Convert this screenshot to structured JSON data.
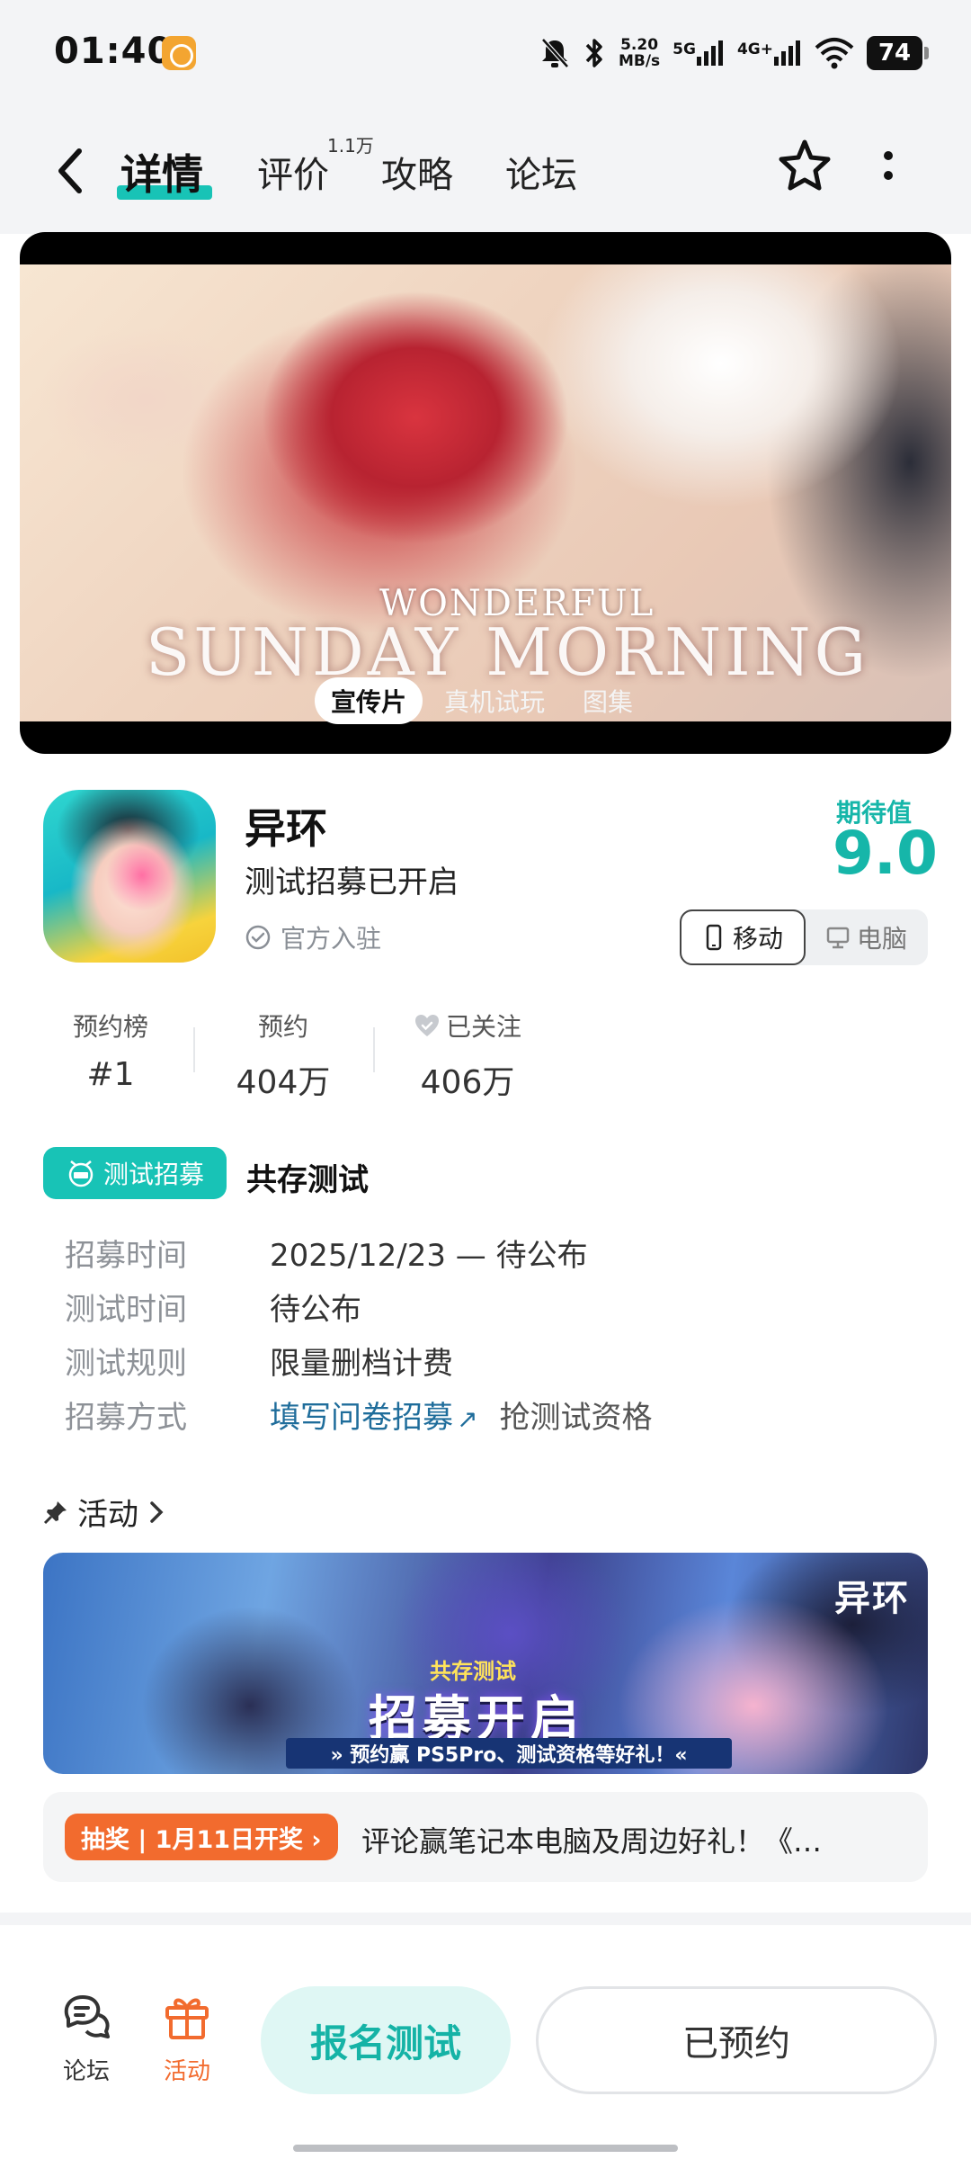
{
  "status_bar": {
    "time": "01:40",
    "net_speed_value": "5.20",
    "net_speed_unit": "MB/s",
    "signal1_label": "5G",
    "signal2_label": "4G+",
    "battery": "74"
  },
  "nav": {
    "tabs": [
      {
        "label": "详情"
      },
      {
        "label": "评价"
      },
      {
        "label": "攻略"
      },
      {
        "label": "论坛"
      }
    ],
    "review_count_badge": "1.1万"
  },
  "hero": {
    "title_line1": "WONDERFUL",
    "title_line2": "SUNDAY MORNING",
    "media_tabs": [
      {
        "label": "宣传片"
      },
      {
        "label": "真机试玩"
      },
      {
        "label": "图集"
      }
    ]
  },
  "game": {
    "name": "异环",
    "subtitle": "测试招募已开启",
    "official_label": "官方入驻",
    "rating_label": "期待值",
    "rating_value": "9.0",
    "platform_mobile": "移动",
    "platform_pc": "电脑"
  },
  "stats": [
    {
      "label": "预约榜",
      "value": "#1"
    },
    {
      "label": "预约",
      "value": "404万"
    },
    {
      "label": "已关注",
      "value": "406万"
    }
  ],
  "recruit": {
    "badge_label": "测试招募",
    "title": "共存测试",
    "rows": [
      {
        "key": "招募时间",
        "value": "2025/12/23 — 待公布"
      },
      {
        "key": "测试时间",
        "value": "待公布"
      },
      {
        "key": "测试规则",
        "value": "限量删档计费"
      },
      {
        "key": "招募方式",
        "value": "填写问卷招募",
        "extra": "抢测试资格"
      }
    ]
  },
  "activity": {
    "heading": "活动",
    "banner_logo": "异环",
    "banner_tag": "共存测试",
    "banner_title": "招募开启",
    "banner_strip": "» 预约赢 PS5Pro、测试资格等好礼！«",
    "lottery_badge": "抽奖 | 1月11日开奖 ›",
    "lottery_text": "评论赢笔记本电脑及周边好礼！《…"
  },
  "bottom_bar": {
    "forum_label": "论坛",
    "activity_label": "活动",
    "signup_button": "报名测试",
    "reserved_button": "已预约"
  },
  "colors": {
    "accent_teal": "#18c3b6",
    "link_blue": "#1f6d9b",
    "lottery_orange": "#f26b2e",
    "activity_orange": "#f26b2e"
  }
}
